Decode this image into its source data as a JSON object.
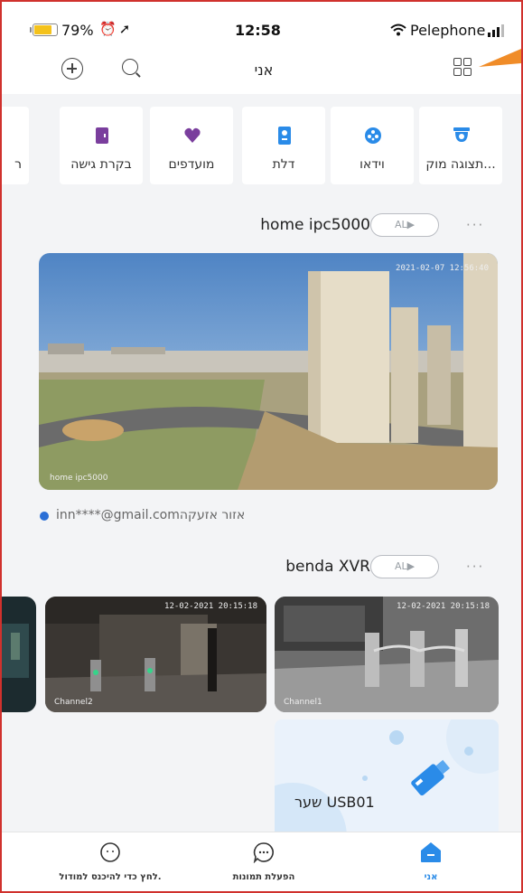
{
  "status_bar": {
    "battery": "79%",
    "battery_level": 0.79,
    "time": "12:58",
    "carrier": "Pelephone"
  },
  "header": {
    "title": "אני",
    "icons": [
      "add-icon",
      "search-icon",
      "grid-view-icon"
    ]
  },
  "categories": [
    {
      "label": "תצוגה מוק...",
      "icon": "camera-icon",
      "color": "#2a8be8"
    },
    {
      "label": "וידאו",
      "icon": "video-icon",
      "color": "#2a8be8"
    },
    {
      "label": "דלת",
      "icon": "door-icon",
      "color": "#2a8be8"
    },
    {
      "label": "מועדפים",
      "icon": "heart-icon",
      "color": "#7a3e9d"
    },
    {
      "label": "בקרת גישה",
      "icon": "access-control-icon",
      "color": "#7a3e9d"
    },
    {
      "label": "ר",
      "icon": "",
      "color": ""
    }
  ],
  "devices": [
    {
      "name": "home ipc5000",
      "pill": "AL▶",
      "more": "···",
      "camera_timestamp": "2021-02-07 12:56:40",
      "camera_label": "home ipc5000",
      "zone": "אזור אזעקה",
      "email": "inn****@gmail.com"
    },
    {
      "name": "benda XVR",
      "pill": "AL▶",
      "more": "···",
      "channels": [
        {
          "label": "Channel1",
          "timestamp": "12-02-2021 20:15:18"
        },
        {
          "label": "Channel2",
          "timestamp": "12-02-2021 20:15:18"
        }
      ],
      "usb_label": "שער USB01"
    }
  ],
  "tabbar": [
    {
      "label": "לחץ כדי להיכנס למודול.",
      "icon": "smiley-icon"
    },
    {
      "label": "הפעלת תמונות",
      "icon": "chat-icon"
    },
    {
      "label": "אני",
      "icon": "home-icon",
      "color": "#2a8be8"
    }
  ],
  "accent_color": "#2a8be8"
}
